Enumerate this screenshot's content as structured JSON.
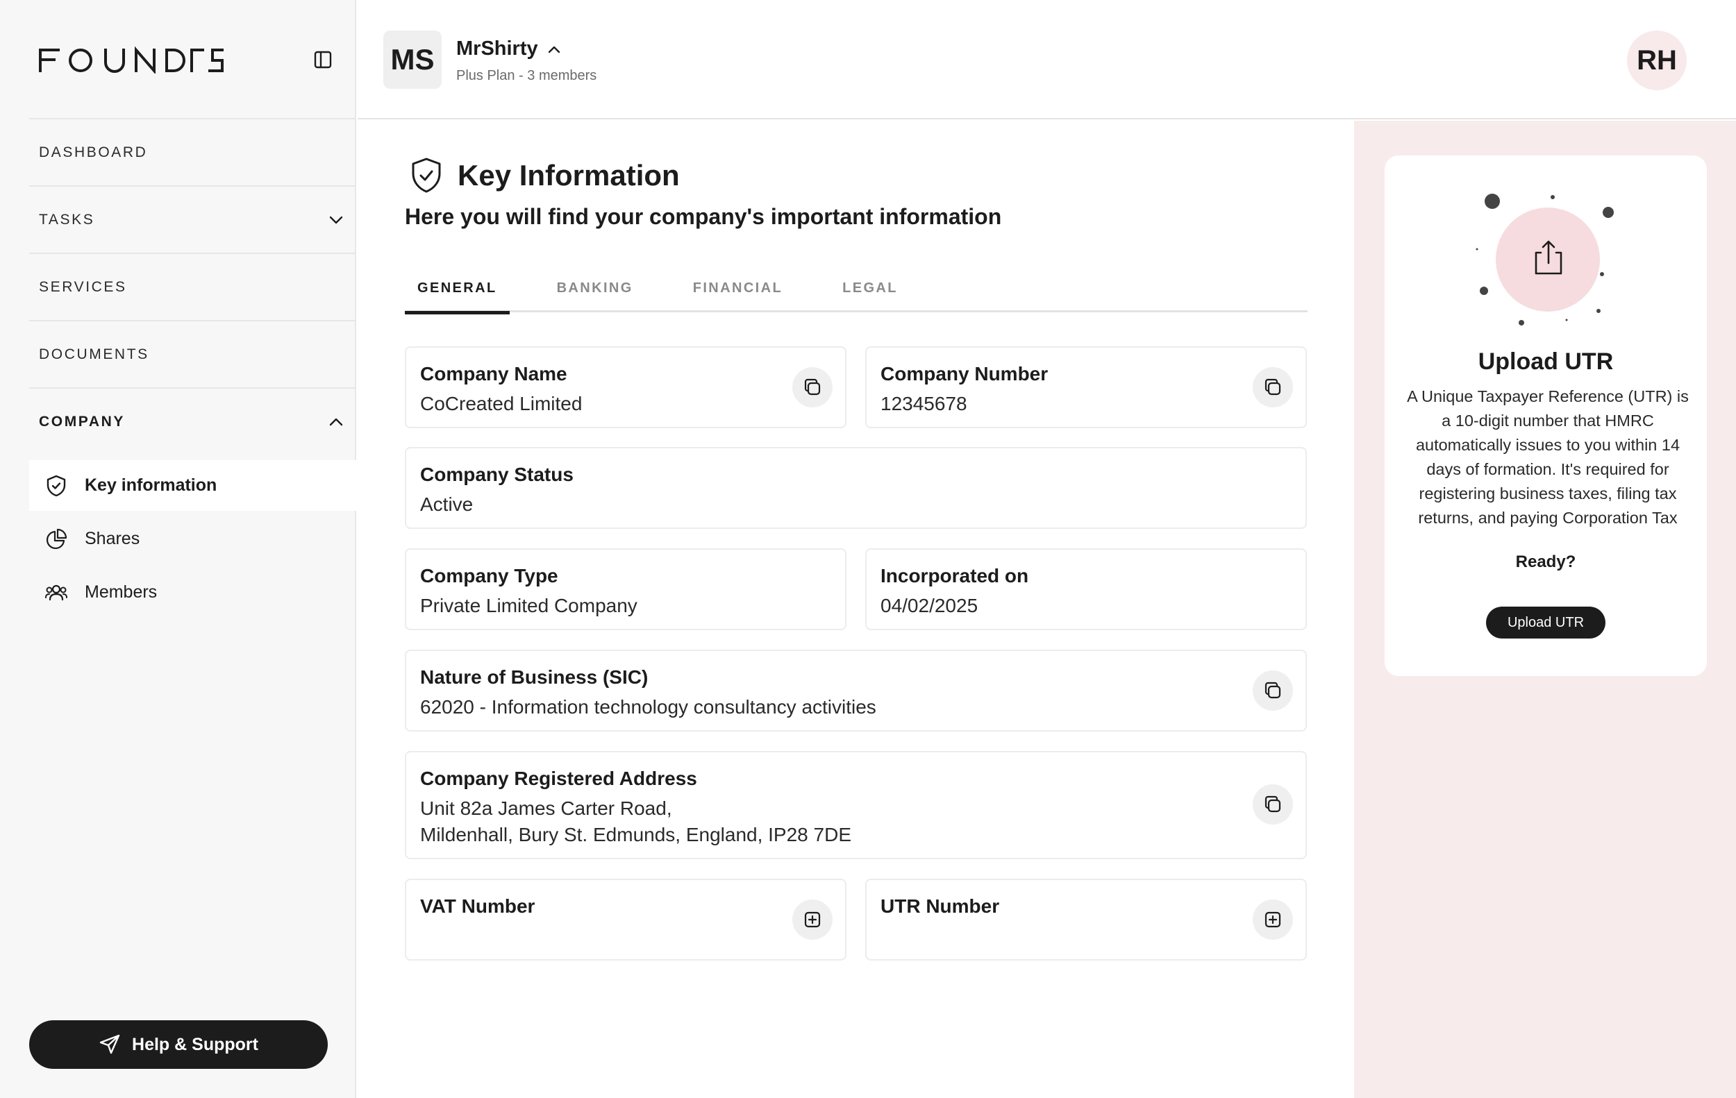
{
  "brand": {
    "logo_text": "FOUNDRS"
  },
  "sidebar": {
    "nav": [
      {
        "label": "DASHBOARD"
      },
      {
        "label": "TASKS"
      },
      {
        "label": "SERVICES"
      },
      {
        "label": "DOCUMENTS"
      },
      {
        "label": "COMPANY"
      }
    ],
    "company_sub": [
      {
        "label": "Key information",
        "icon": "shield-check-icon"
      },
      {
        "label": "Shares",
        "icon": "pie-chart-icon"
      },
      {
        "label": "Members",
        "icon": "users-icon"
      }
    ],
    "help_label": "Help & Support"
  },
  "header": {
    "org_initials": "MS",
    "org_name": "MrShirty",
    "org_plan": "Plus Plan - 3 members",
    "user_initials": "RH"
  },
  "main": {
    "title": "Key Information",
    "subtitle": "Here you will find your company's important information",
    "tabs": [
      {
        "label": "GENERAL",
        "active": true
      },
      {
        "label": "BANKING",
        "active": false
      },
      {
        "label": "FINANCIAL",
        "active": false
      },
      {
        "label": "LEGAL",
        "active": false
      }
    ],
    "fields": {
      "company_name": {
        "label": "Company Name",
        "value": "CoCreated Limited"
      },
      "company_number": {
        "label": "Company Number",
        "value": "12345678"
      },
      "company_status": {
        "label": "Company Status",
        "value": "Active"
      },
      "company_type": {
        "label": "Company Type",
        "value": "Private Limited Company"
      },
      "incorporated_on": {
        "label": "Incorporated on",
        "value": "04/02/2025"
      },
      "nature_of_business": {
        "label": "Nature of Business (SIC)",
        "value": "62020 - Information technology consultancy activities"
      },
      "registered_address": {
        "label": "Company Registered Address",
        "line1": "Unit 82a James Carter Road,",
        "line2": "Mildenhall, Bury St. Edmunds, England, IP28 7DE"
      },
      "vat_number": {
        "label": "VAT Number"
      },
      "utr_number": {
        "label": "UTR Number"
      }
    }
  },
  "utr_panel": {
    "title": "Upload UTR",
    "description": "A Unique Taxpayer Reference (UTR) is a 10-digit number that HMRC automatically issues to you within 14 days of formation. It's required for registering business taxes, filing tax returns, and paying Corporation Tax",
    "ready": "Ready?",
    "button_label": "Upload UTR"
  },
  "colors": {
    "dark": "#1c1c1c",
    "accent_pink": "#f8ebeb",
    "upload_circle": "#f6dcdf",
    "sidebar_bg": "#f7f7f7"
  }
}
